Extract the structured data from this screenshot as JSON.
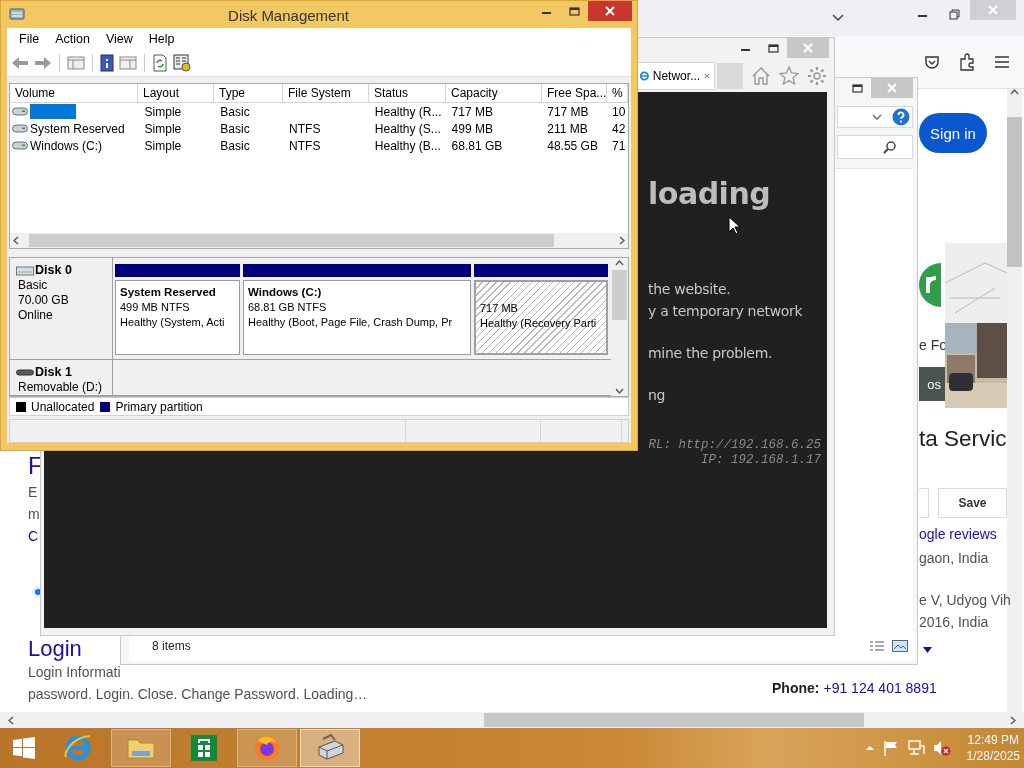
{
  "firefox_window": {
    "sign_in": "Sign in",
    "card_texts": [
      "e Fo",
      "os"
    ],
    "heading": "ta Servic",
    "buttons": [
      "Save"
    ],
    "reviews_link": "ogle reviews",
    "address_lines": [
      "gaon, India"
    ],
    "address2_lines": [
      "e V, Udyog Vih",
      "2016, India"
    ],
    "phone_label": "Phone:",
    "phone": "+91 124 401 8891",
    "left_title": "F",
    "left_lines": [
      "E",
      "m"
    ],
    "left_link": "C",
    "login_title": "Login",
    "login_lines": [
      "Login Informati",
      "password. Login. Close. Change Password. Loading…"
    ]
  },
  "explorer_window": {
    "status": "8 items"
  },
  "ie_window": {
    "tab": {
      "title": "Networ...",
      "selected": true
    },
    "heading": "loading",
    "paragraphs": [
      [
        "the website.",
        "y a temporary network"
      ],
      [
        "mine the problem."
      ],
      [
        "ng"
      ]
    ],
    "url": "RL: http://192.168.6.25",
    "ip": "IP: 192.168.1.17"
  },
  "disk_management": {
    "title": "Disk Management",
    "menu": [
      "File",
      "Action",
      "View",
      "Help"
    ],
    "volume_table": {
      "columns": [
        "Volume",
        "Layout",
        "Type",
        "File System",
        "Status",
        "Capacity",
        "Free Spa...",
        "%"
      ],
      "rows": [
        {
          "selected": true,
          "cells": [
            "",
            "Simple",
            "Basic",
            "",
            "Healthy (R...",
            "717 MB",
            "717 MB",
            "10"
          ]
        },
        {
          "selected": false,
          "cells": [
            "System Reserved",
            "Simple",
            "Basic",
            "NTFS",
            "Healthy (S...",
            "499 MB",
            "211 MB",
            "42"
          ]
        },
        {
          "selected": false,
          "cells": [
            "Windows (C:)",
            "Simple",
            "Basic",
            "NTFS",
            "Healthy (B...",
            "68.81 GB",
            "48.55 GB",
            "71"
          ]
        }
      ]
    },
    "disks": [
      {
        "kind": "fixed",
        "name": "Disk 0",
        "details": [
          "Basic",
          "70.00 GB",
          "Online"
        ],
        "partitions": [
          {
            "title": "System Reserved",
            "size": "499 MB NTFS",
            "status": "Healthy (System, Acti",
            "selected": false
          },
          {
            "title": "Windows  (C:)",
            "size": "68.81 GB NTFS",
            "status": "Healthy (Boot, Page File, Crash Dump, Pr",
            "selected": false
          },
          {
            "size": "717 MB",
            "status": "Healthy (Recovery Parti",
            "selected": true
          }
        ]
      },
      {
        "kind": "removable",
        "name": "Disk 1",
        "details": [
          "Removable (D:)"
        ]
      }
    ],
    "legend": [
      {
        "label": "Unallocated",
        "color": "#000000"
      },
      {
        "label": "Primary partition",
        "color": "#00007f"
      }
    ]
  },
  "taskbar": {
    "apps": [
      {
        "kind": "ie",
        "running": false,
        "selected": false
      },
      {
        "kind": "explorer",
        "running": true,
        "selected": false
      },
      {
        "kind": "store",
        "running": false,
        "selected": false
      },
      {
        "kind": "firefox",
        "running": true,
        "selected": false
      },
      {
        "kind": "diskmgmt",
        "running": true,
        "selected": true
      }
    ],
    "time": "12:49 PM",
    "date": "1/28/2025"
  }
}
